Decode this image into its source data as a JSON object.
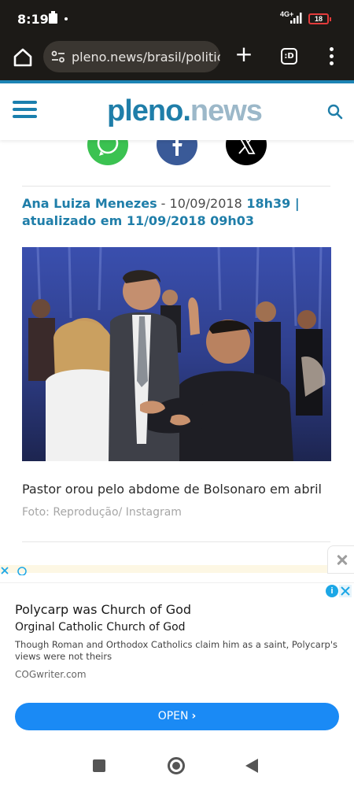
{
  "status_bar": {
    "time": "8:19",
    "network": "4G+",
    "battery": "18",
    "battery_color": "#e23b3b"
  },
  "browser": {
    "url": "pleno.news/brasil/politica-",
    "tab_count": ":D",
    "new_tab_label": "+",
    "theme_color": "#1c1a17"
  },
  "site": {
    "logo_part1": "pleno",
    "logo_dot": ".",
    "logo_part2": "news",
    "accent": "#1f7ea9"
  },
  "article": {
    "share_buttons": [
      "whatsapp",
      "facebook",
      "x"
    ],
    "author": "Ana Luiza Menezes",
    "separator": " - ",
    "published_date": "10/09/2018",
    "published_time": "18h39",
    "updated_label": "| atualizado em 11/09/2018 09h03",
    "photo_alt": "Pastor orou pelo abdome de Bolsonaro em abril",
    "caption": "Pastor orou pelo abdome de Bolsonaro em abril",
    "credit": "Foto: Reprodução/ Instagram"
  },
  "ad": {
    "title": "Polycarp was Church of God",
    "subtitle": "Orginal Catholic Church of God",
    "description": "Though Roman and Orthodox Catholics claim him as a saint, Polycarp's views were not theirs",
    "domain": "COGwriter.com",
    "cta": "OPEN",
    "cta_color": "#1a8af5",
    "info_icon": "i"
  },
  "nav": {
    "icons": [
      "recents-icon",
      "home-icon",
      "back-icon"
    ]
  }
}
